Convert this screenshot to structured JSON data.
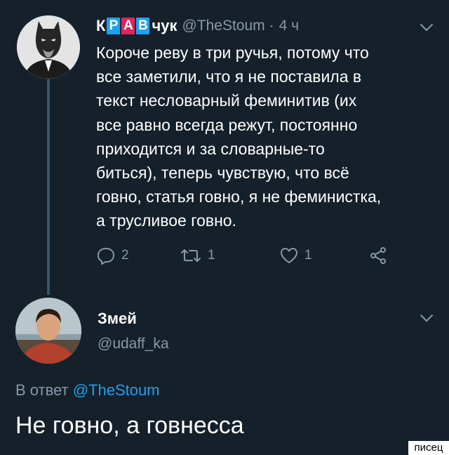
{
  "tweet": {
    "name_letters": [
      "Р",
      "А",
      "В"
    ],
    "name_prefix": "К",
    "name_suffix": "чук",
    "handle": "@TheStoum",
    "separator": "·",
    "time": "4 ч",
    "text": "Короче реву в три ручья, потому что\nвсе заметили, что я не поставила в\nтекст несловарный феминитив (их\nвсе равно всегда режут, постоянно\nприходится и за словарные-то\nбиться), теперь чувствую, что всё\nговно, статья говно, я не феминистка,\nа трусливое говно.",
    "actions": {
      "reply_count": "2",
      "retweet_count": "1",
      "like_count": "1"
    },
    "icons": {
      "caret": "chevron-down-icon",
      "reply": "reply-icon",
      "retweet": "retweet-icon",
      "like": "heart-icon",
      "share": "share-icon"
    }
  },
  "reply": {
    "name": "Змей",
    "handle": "@udaff_ka",
    "reply_to_prefix": "В ответ",
    "reply_to_handle": "@TheStoum",
    "text": "Не говно, а говнесса"
  },
  "watermark": "писец",
  "colors": {
    "background": "#15202b",
    "text": "#ffffff",
    "secondary": "#8899a6",
    "link": "#1da1f2",
    "tile_blue": "#1da1f2",
    "tile_red": "#e0245e",
    "thread_line": "#3d5466"
  }
}
